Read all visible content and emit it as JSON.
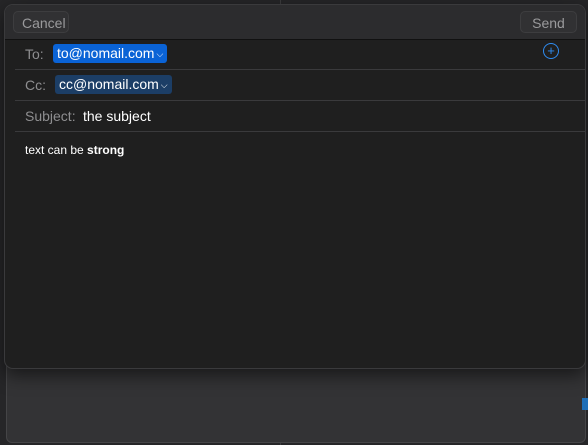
{
  "toolbar": {
    "cancel_label": "Cancel",
    "send_label": "Send"
  },
  "to": {
    "label": "To:",
    "address": "to@nomail.com"
  },
  "cc": {
    "label": "Cc:",
    "address": "cc@nomail.com"
  },
  "subject": {
    "label": "Subject:",
    "value": "the subject"
  },
  "body": {
    "text_prefix": "text can be ",
    "text_strong": "strong"
  },
  "icons": {
    "add": "plus-circle-icon",
    "chevron": "chevron-down-icon"
  },
  "colors": {
    "accent": "#0a63d6",
    "cc_token": "#1c3e66",
    "add_icon": "#2f8cf0"
  }
}
